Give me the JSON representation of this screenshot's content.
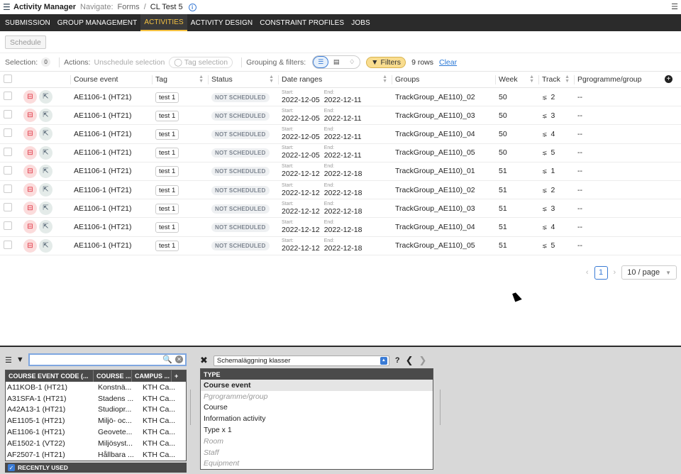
{
  "topbar": {
    "app_title": "Activity Manager",
    "navigate_label": "Navigate:",
    "crumb_forms": "Forms",
    "crumb_sep": "/",
    "crumb_current": "CL Test 5",
    "info_glyph": "i"
  },
  "nav": {
    "tabs": [
      "SUBMISSION",
      "GROUP MANAGEMENT",
      "ACTIVITIES",
      "ACTIVITY DESIGN",
      "CONSTRAINT PROFILES",
      "JOBS"
    ],
    "active_index": 2
  },
  "schedule_button": "Schedule",
  "toolbar": {
    "selection_label": "Selection:",
    "selection_count": "0",
    "actions_label": "Actions:",
    "unschedule_label": "Unschedule selection",
    "tag_selection_label": "Tag selection",
    "grouping_label": "Grouping & filters:",
    "filters_label": "Filters",
    "rows_label": "9 rows",
    "clear_label": "Clear"
  },
  "table": {
    "headers": [
      "Course event",
      "Tag",
      "Status",
      "Date ranges",
      "Groups",
      "Week",
      "Track",
      "Pgrogramme/group"
    ],
    "start_label": "Start:",
    "end_label": "End:",
    "rows": [
      {
        "course": "AE1106-1 (HT21)",
        "tag": "test 1",
        "status": "NOT SCHEDULED",
        "start": "2022-12-05",
        "end": "2022-12-11",
        "group": "TrackGroup_AE110)_02",
        "week": "50",
        "track": "2",
        "prog": "--"
      },
      {
        "course": "AE1106-1 (HT21)",
        "tag": "test 1",
        "status": "NOT SCHEDULED",
        "start": "2022-12-05",
        "end": "2022-12-11",
        "group": "TrackGroup_AE110)_03",
        "week": "50",
        "track": "3",
        "prog": "--"
      },
      {
        "course": "AE1106-1 (HT21)",
        "tag": "test 1",
        "status": "NOT SCHEDULED",
        "start": "2022-12-05",
        "end": "2022-12-11",
        "group": "TrackGroup_AE110)_04",
        "week": "50",
        "track": "4",
        "prog": "--"
      },
      {
        "course": "AE1106-1 (HT21)",
        "tag": "test 1",
        "status": "NOT SCHEDULED",
        "start": "2022-12-05",
        "end": "2022-12-11",
        "group": "TrackGroup_AE110)_05",
        "week": "50",
        "track": "5",
        "prog": "--"
      },
      {
        "course": "AE1106-1 (HT21)",
        "tag": "test 1",
        "status": "NOT SCHEDULED",
        "start": "2022-12-12",
        "end": "2022-12-18",
        "group": "TrackGroup_AE110)_01",
        "week": "51",
        "track": "1",
        "prog": "--"
      },
      {
        "course": "AE1106-1 (HT21)",
        "tag": "test 1",
        "status": "NOT SCHEDULED",
        "start": "2022-12-12",
        "end": "2022-12-18",
        "group": "TrackGroup_AE110)_02",
        "week": "51",
        "track": "2",
        "prog": "--"
      },
      {
        "course": "AE1106-1 (HT21)",
        "tag": "test 1",
        "status": "NOT SCHEDULED",
        "start": "2022-12-12",
        "end": "2022-12-18",
        "group": "TrackGroup_AE110)_03",
        "week": "51",
        "track": "3",
        "prog": "--"
      },
      {
        "course": "AE1106-1 (HT21)",
        "tag": "test 1",
        "status": "NOT SCHEDULED",
        "start": "2022-12-12",
        "end": "2022-12-18",
        "group": "TrackGroup_AE110)_04",
        "week": "51",
        "track": "4",
        "prog": "--"
      },
      {
        "course": "AE1106-1 (HT21)",
        "tag": "test 1",
        "status": "NOT SCHEDULED",
        "start": "2022-12-12",
        "end": "2022-12-18",
        "group": "TrackGroup_AE110)_05",
        "week": "51",
        "track": "5",
        "prog": "--"
      }
    ]
  },
  "pagination": {
    "current_page": "1",
    "page_size": "10 / page"
  },
  "left_panel": {
    "search_value": "",
    "headers": [
      "COURSE EVENT CODE (...",
      "COURSE ...",
      "CAMPUS ...",
      "+"
    ],
    "rows": [
      [
        "A11KOB-1 (HT21)",
        "Konstnä...",
        "KTH Ca..."
      ],
      [
        "A31SFA-1 (HT21)",
        "Stadens ...",
        "KTH Ca..."
      ],
      [
        "A42A13-1 (HT21)",
        "Studiopr...",
        "KTH Ca..."
      ],
      [
        "AE1105-1 (HT21)",
        "Miljö- oc...",
        "KTH Ca..."
      ],
      [
        "AE1106-1 (HT21)",
        "Geovete...",
        "KTH Ca..."
      ],
      [
        "AE1502-1 (VT22)",
        "Miljösyst...",
        "KTH Ca..."
      ],
      [
        "AF2507-1 (HT21)",
        "Hållbara ...",
        "KTH Ca..."
      ]
    ],
    "footer_label": "RECENTLY USED"
  },
  "right_panel": {
    "select_value": "Schemaläggning klasser",
    "help_glyph": "?",
    "header": "TYPE",
    "items": [
      {
        "label": "Course event",
        "style": "selected"
      },
      {
        "label": "Pgrogramme/group",
        "style": "dim"
      },
      {
        "label": "Course",
        "style": "normal"
      },
      {
        "label": "Information activity",
        "style": "normal"
      },
      {
        "label": "Type x 1",
        "style": "normal"
      },
      {
        "label": "Room",
        "style": "dim"
      },
      {
        "label": "Staff",
        "style": "dim"
      },
      {
        "label": "Equipment",
        "style": "dim"
      }
    ]
  },
  "colors": {
    "nav_bg": "#2b2b2b",
    "active_tab": "#f5c242",
    "link": "#2a78d6",
    "filters_bg": "#f9dd8f"
  }
}
